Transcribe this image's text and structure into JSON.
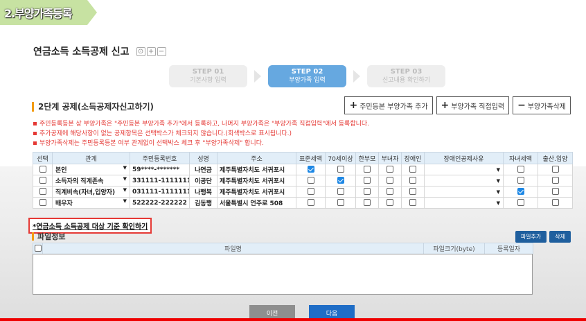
{
  "banner": "2.부양가족등록",
  "page_title": "연금소득 소득공제 신고",
  "title_buttons": [
    "⊙",
    "+",
    "−"
  ],
  "steps": [
    {
      "num": "STEP 01",
      "label": "기본사항 입력"
    },
    {
      "num": "STEP 02",
      "label": "부양가족 입력"
    },
    {
      "num": "STEP 03",
      "label": "신고내용 확인하기"
    }
  ],
  "section_title": "2단계 공제(소득공제자신고하기)",
  "action_buttons": [
    {
      "sym": "+",
      "label": "주민등본 부양가족 추가"
    },
    {
      "sym": "+",
      "label": "부양가족 직접입력"
    },
    {
      "sym": "−",
      "label": "부양가족삭제"
    }
  ],
  "notes": [
    "주민등록등본 상 부양가족은 \"주민등본 부양가족 추가\"에서 등록하고, 나머지 부양가족은 \"부양가족 직접입력\"에서 등록합니다.",
    "추가공제에 해당사항이 없는 공제항목은 선택박스가 체크되지 않습니다.(회색박스로 표시됩니다.)",
    "부양가족삭제는 주민등록등본 여부 관계없이 선택박스 체크 후 \"부양가족삭제\" 합니다."
  ],
  "table": {
    "headers": [
      "선택",
      "관계",
      "주민등록번호",
      "성명",
      "주소",
      "표준세액",
      "70세이상",
      "한부모",
      "부녀자",
      "장애인",
      "장애인공제사유",
      "자녀세액",
      "출산.입양"
    ],
    "rows": [
      {
        "relation": "본인",
        "id": "59****-*******",
        "name": "나연금",
        "address": "제주특별자치도 서귀포시",
        "checks": [
          true,
          false,
          false,
          false,
          false
        ],
        "child": false,
        "birth": false
      },
      {
        "relation": "소득자의 직계존속",
        "id": "331111-1111111",
        "name": "이공단",
        "address": "제주특별자치도 서귀포시",
        "checks": [
          false,
          true,
          false,
          false,
          false
        ],
        "child": false,
        "birth": false
      },
      {
        "relation": "직계비속(자녀,입양자)",
        "id": "031111-1111111",
        "name": "나행복",
        "address": "제주특별자치도 서귀포시",
        "checks": [
          false,
          false,
          false,
          false,
          false
        ],
        "child": true,
        "birth": false
      },
      {
        "relation": "배우자",
        "id": "522222-222222",
        "name": "김동행",
        "address": "서울특별시 언주로 508",
        "checks": [
          false,
          false,
          false,
          false,
          false
        ],
        "child": false,
        "birth": false
      }
    ]
  },
  "criteria_link": "*연금소득 소득공제 대상 기준 확인하기",
  "files": {
    "title": "파일정보",
    "add_label": "파일추가",
    "delete_label": "삭제",
    "headers": [
      "",
      "파일명",
      "파일크기(byte)",
      "등록일자"
    ]
  },
  "nav": {
    "prev": "이전",
    "next": "다음"
  },
  "colors": {
    "accent": "#66a8e0",
    "note_red": "#e53935",
    "header_blue": "#e2eef8"
  }
}
